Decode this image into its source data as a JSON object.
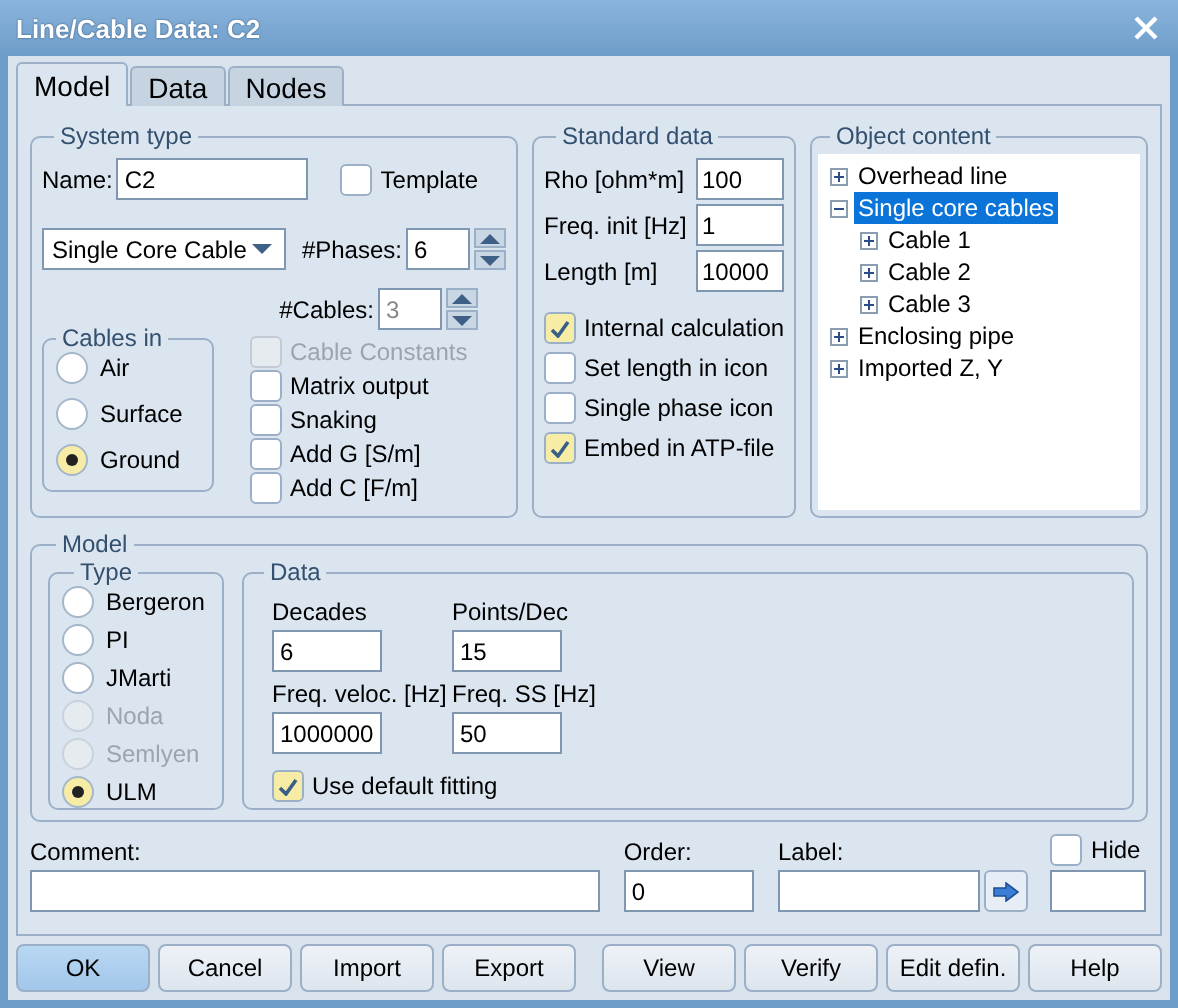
{
  "window": {
    "title": "Line/Cable Data: C2"
  },
  "tabs": [
    {
      "label": "Model",
      "selected": true
    },
    {
      "label": "Data",
      "selected": false
    },
    {
      "label": "Nodes",
      "selected": false
    }
  ],
  "system_type": {
    "title": "System type",
    "name_label": "Name:",
    "name_value": "C2",
    "template": {
      "label": "Template",
      "checked": false
    },
    "cable_type": "Single Core Cable",
    "phases": {
      "label": "#Phases:",
      "value": "6",
      "disabled": false
    },
    "cables": {
      "label": "#Cables:",
      "value": "3",
      "disabled": true
    },
    "cables_in": {
      "title": "Cables in",
      "options": [
        {
          "label": "Air",
          "selected": false
        },
        {
          "label": "Surface",
          "selected": false
        },
        {
          "label": "Ground",
          "selected": true
        }
      ]
    },
    "checks": [
      {
        "label": "Cable Constants",
        "checked": false,
        "disabled": true
      },
      {
        "label": "Matrix output",
        "checked": false,
        "disabled": false
      },
      {
        "label": "Snaking",
        "checked": false,
        "disabled": false
      },
      {
        "label": "Add G [S/m]",
        "checked": false,
        "disabled": false
      },
      {
        "label": "Add C [F/m]",
        "checked": false,
        "disabled": false
      }
    ]
  },
  "standard_data": {
    "title": "Standard data",
    "fields": [
      {
        "label": "Rho [ohm*m]",
        "value": "100"
      },
      {
        "label": "Freq. init [Hz]",
        "value": "1"
      },
      {
        "label": "Length [m]",
        "value": "10000"
      }
    ],
    "checks": [
      {
        "label": "Internal calculation",
        "checked": true
      },
      {
        "label": "Set length in icon",
        "checked": false
      },
      {
        "label": "Single phase icon",
        "checked": false
      },
      {
        "label": "Embed in ATP-file",
        "checked": true
      }
    ]
  },
  "object_content": {
    "title": "Object content",
    "tree": [
      {
        "label": "Overhead line",
        "expanded": false,
        "selected": false
      },
      {
        "label": "Single core cables",
        "expanded": true,
        "selected": true,
        "children": [
          {
            "label": "Cable 1",
            "expanded": false,
            "selected": false
          },
          {
            "label": "Cable 2",
            "expanded": false,
            "selected": false
          },
          {
            "label": "Cable 3",
            "expanded": false,
            "selected": false
          }
        ]
      },
      {
        "label": "Enclosing pipe",
        "expanded": false,
        "selected": false
      },
      {
        "label": "Imported Z, Y",
        "expanded": false,
        "selected": false
      }
    ]
  },
  "model": {
    "title": "Model",
    "type": {
      "title": "Type",
      "options": [
        {
          "label": "Bergeron",
          "selected": false,
          "disabled": false
        },
        {
          "label": "PI",
          "selected": false,
          "disabled": false
        },
        {
          "label": "JMarti",
          "selected": false,
          "disabled": false
        },
        {
          "label": "Noda",
          "selected": false,
          "disabled": true
        },
        {
          "label": "Semlyen",
          "selected": false,
          "disabled": true
        },
        {
          "label": "ULM",
          "selected": true,
          "disabled": false
        }
      ]
    },
    "data": {
      "title": "Data",
      "fields": [
        {
          "label": "Decades",
          "value": "6"
        },
        {
          "label": "Points/Dec",
          "value": "15"
        },
        {
          "label": "Freq. veloc. [Hz]",
          "value": "1000000"
        },
        {
          "label": "Freq. SS [Hz]",
          "value": "50"
        }
      ],
      "use_default_fitting": {
        "label": "Use default fitting",
        "checked": true
      }
    }
  },
  "comment": {
    "label": "Comment:"
  },
  "order": {
    "label": "Order:",
    "value": "0"
  },
  "label_field": {
    "label": "Label:"
  },
  "hide": {
    "label": "Hide",
    "checked": false
  },
  "buttons": [
    {
      "label": "OK",
      "default": true
    },
    {
      "label": "Cancel",
      "default": false
    },
    {
      "label": "Import",
      "default": false
    },
    {
      "label": "Export",
      "default": false
    },
    {
      "label": "View",
      "default": false
    },
    {
      "label": "Verify",
      "default": false
    },
    {
      "label": "Edit defin.",
      "default": false
    },
    {
      "label": "Help",
      "default": false
    }
  ]
}
